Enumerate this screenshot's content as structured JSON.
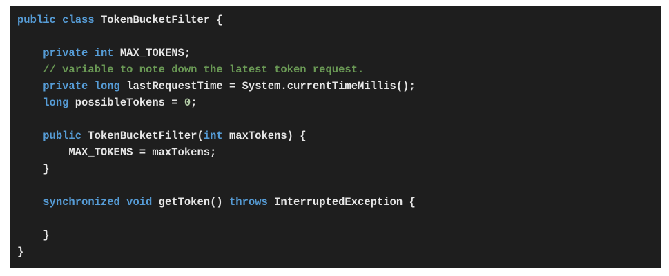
{
  "code": {
    "lines": [
      [
        {
          "t": "public",
          "c": "kw"
        },
        {
          "t": " ",
          "c": "pl"
        },
        {
          "t": "class",
          "c": "kw"
        },
        {
          "t": " TokenBucketFilter {",
          "c": "pl"
        }
      ],
      [],
      [
        {
          "t": "    ",
          "c": "pl"
        },
        {
          "t": "private",
          "c": "kw"
        },
        {
          "t": " ",
          "c": "pl"
        },
        {
          "t": "int",
          "c": "kw"
        },
        {
          "t": " MAX_TOKENS;",
          "c": "pl"
        }
      ],
      [
        {
          "t": "    ",
          "c": "pl"
        },
        {
          "t": "// variable to note down the latest token request.",
          "c": "cm"
        }
      ],
      [
        {
          "t": "    ",
          "c": "pl"
        },
        {
          "t": "private",
          "c": "kw"
        },
        {
          "t": " ",
          "c": "pl"
        },
        {
          "t": "long",
          "c": "kw"
        },
        {
          "t": " lastRequestTime = System.currentTimeMillis();",
          "c": "pl"
        }
      ],
      [
        {
          "t": "    ",
          "c": "pl"
        },
        {
          "t": "long",
          "c": "kw"
        },
        {
          "t": " possibleTokens = ",
          "c": "pl"
        },
        {
          "t": "0",
          "c": "num"
        },
        {
          "t": ";",
          "c": "pl"
        }
      ],
      [],
      [
        {
          "t": "    ",
          "c": "pl"
        },
        {
          "t": "public",
          "c": "kw"
        },
        {
          "t": " TokenBucketFilter(",
          "c": "pl"
        },
        {
          "t": "int",
          "c": "kw"
        },
        {
          "t": " maxTokens) {",
          "c": "pl"
        }
      ],
      [
        {
          "t": "        MAX_TOKENS = maxTokens;",
          "c": "pl"
        }
      ],
      [
        {
          "t": "    }",
          "c": "pl"
        }
      ],
      [],
      [
        {
          "t": "    ",
          "c": "pl"
        },
        {
          "t": "synchronized",
          "c": "kw"
        },
        {
          "t": " ",
          "c": "pl"
        },
        {
          "t": "void",
          "c": "kw"
        },
        {
          "t": " getToken() ",
          "c": "pl"
        },
        {
          "t": "throws",
          "c": "kw"
        },
        {
          "t": " InterruptedException {",
          "c": "pl"
        }
      ],
      [],
      [
        {
          "t": "    }",
          "c": "pl"
        }
      ],
      [
        {
          "t": "}",
          "c": "pl"
        }
      ]
    ]
  }
}
